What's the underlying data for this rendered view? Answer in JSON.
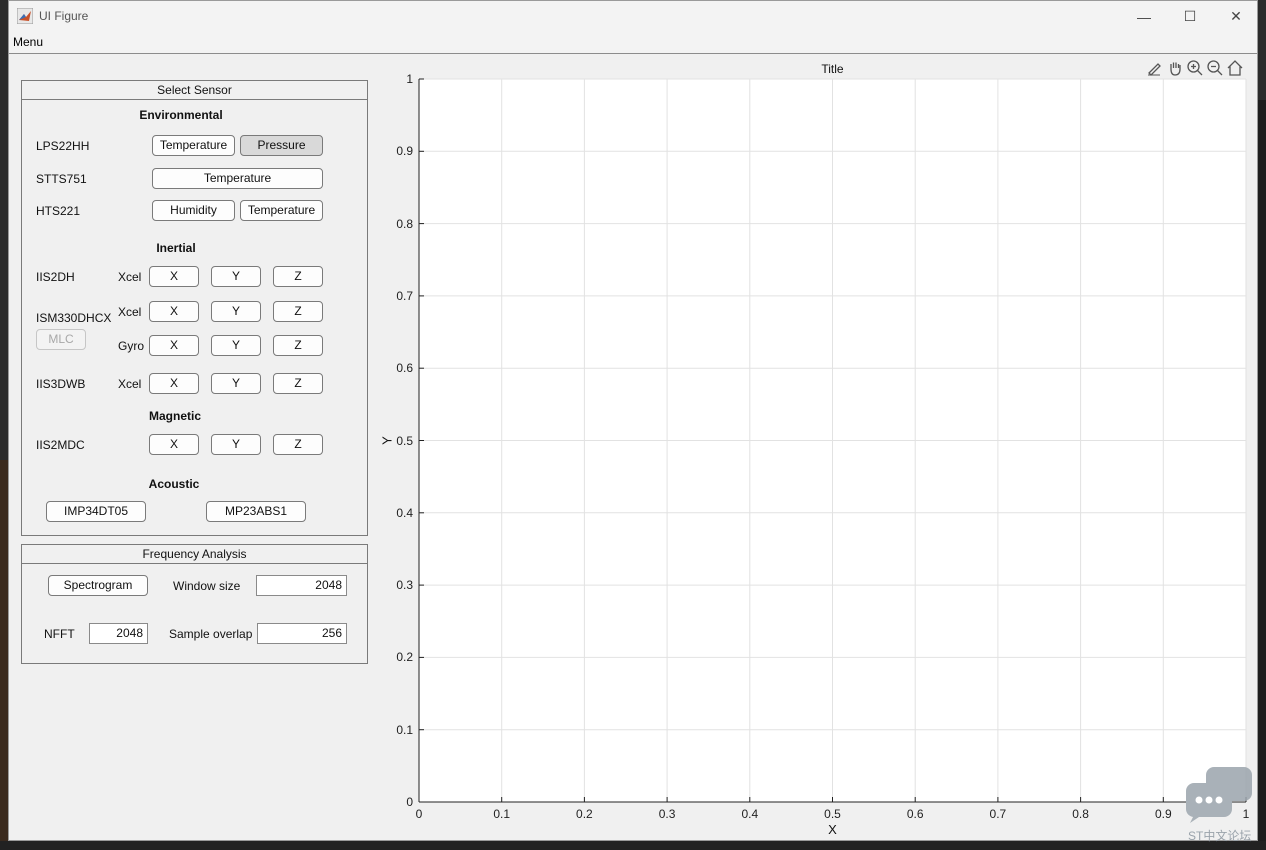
{
  "window": {
    "title": "UI Figure",
    "controls": {
      "minimize": "—",
      "maximize": "☐",
      "close": "✕"
    }
  },
  "menu": {
    "label": "Menu"
  },
  "select_sensor": {
    "title": "Select Sensor",
    "environmental": {
      "heading": "Environmental",
      "lps22hh": {
        "label": "LPS22HH",
        "btn1": "Temperature",
        "btn2": "Pressure"
      },
      "stts751": {
        "label": "STTS751",
        "btn1": "Temperature"
      },
      "hts221": {
        "label": "HTS221",
        "btn1": "Humidity",
        "btn2": "Temperature"
      }
    },
    "inertial": {
      "heading": "Inertial",
      "iis2dh": {
        "label": "IIS2DH",
        "sub": "Xcel",
        "x": "X",
        "y": "Y",
        "z": "Z"
      },
      "ism330dhcx": {
        "label": "ISM330DHCX",
        "mlc": "MLC",
        "sub1": "Xcel",
        "sub2": "Gyro",
        "x": "X",
        "y": "Y",
        "z": "Z"
      },
      "iis3dwb": {
        "label": "IIS3DWB",
        "sub": "Xcel",
        "x": "X",
        "y": "Y",
        "z": "Z"
      }
    },
    "magnetic": {
      "heading": "Magnetic",
      "iis2mdc": {
        "label": "IIS2MDC",
        "x": "X",
        "y": "Y",
        "z": "Z"
      }
    },
    "acoustic": {
      "heading": "Acoustic",
      "btn1": "IMP34DT05",
      "btn2": "MP23ABS1"
    }
  },
  "frequency_analysis": {
    "title": "Frequency Analysis",
    "spectrogram": "Spectrogram",
    "window_size_label": "Window size",
    "window_size": "2048",
    "nfft_label": "NFFT",
    "nfft": "2048",
    "overlap_label": "Sample overlap",
    "overlap": "256"
  },
  "chart_data": {
    "type": "line",
    "title": "Title",
    "xlabel": "X",
    "ylabel": "Y",
    "xlim": [
      0,
      1
    ],
    "ylim": [
      0,
      1
    ],
    "xticks": [
      "0",
      "0.1",
      "0.2",
      "0.3",
      "0.4",
      "0.5",
      "0.6",
      "0.7",
      "0.8",
      "0.9",
      "1"
    ],
    "yticks": [
      "0",
      "0.1",
      "0.2",
      "0.3",
      "0.4",
      "0.5",
      "0.6",
      "0.7",
      "0.8",
      "0.9",
      "1"
    ],
    "grid": true,
    "series": []
  },
  "axes_toolbar": [
    "brush-icon",
    "pan-icon",
    "zoom-in-icon",
    "zoom-out-icon",
    "home-icon"
  ],
  "watermark": {
    "text": "ST中文论坛"
  }
}
